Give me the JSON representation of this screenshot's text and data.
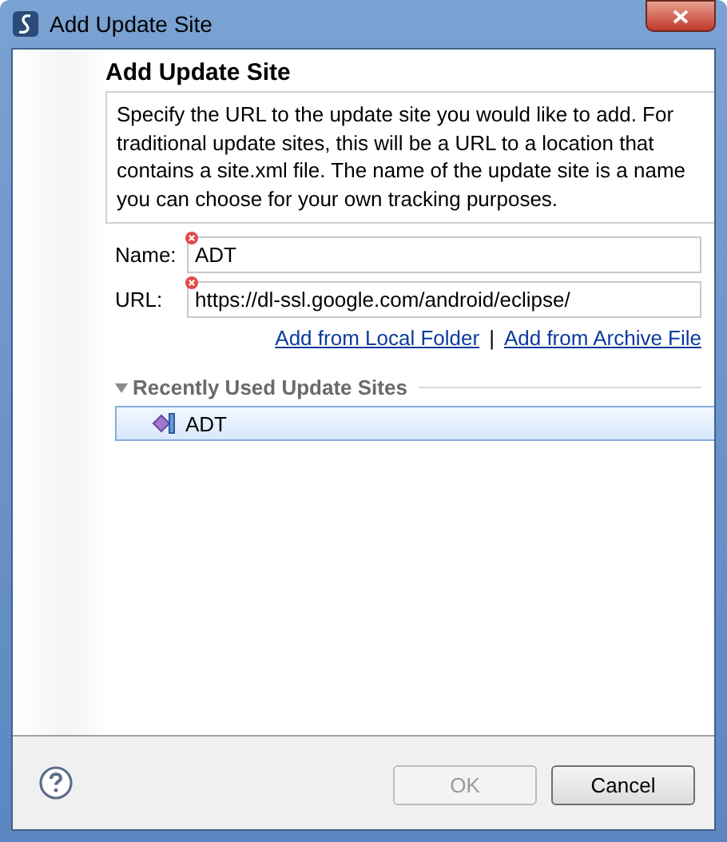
{
  "window": {
    "title": "Add Update Site"
  },
  "heading": "Add Update Site",
  "description": "Specify the URL to the update site you would like to add.  For traditional update sites, this will be a URL to a location that contains a site.xml file.  The name of the update site is a name you can choose for your own tracking purposes.",
  "fields": [
    {
      "label": "Name:",
      "value": "ADT",
      "error": true
    },
    {
      "label": "URL:",
      "value": "https://dl-ssl.google.com/android/eclipse/",
      "error": true
    }
  ],
  "links": [
    "Add from Local Folder",
    "|",
    "Add from Archive File"
  ],
  "recent": {
    "title": "Recently Used Update Sites",
    "expanded": true,
    "items": [
      {
        "label": "ADT",
        "selected": true
      }
    ]
  },
  "buttons": [
    {
      "label": "OK",
      "disabled": true
    },
    {
      "label": "Cancel",
      "disabled": false
    }
  ]
}
